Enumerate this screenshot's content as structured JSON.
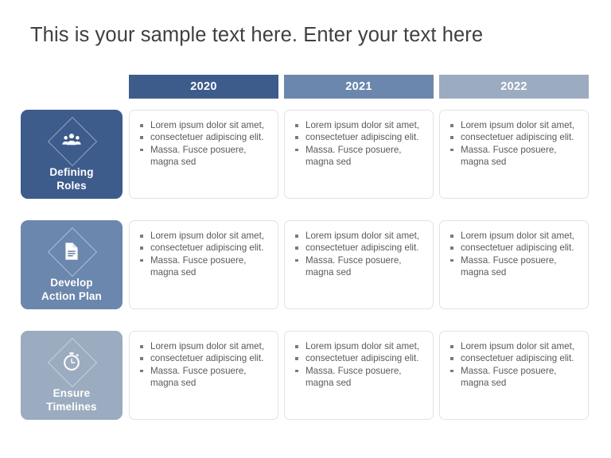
{
  "slide": {
    "title": "This is your sample text here. Enter your text here",
    "background_color": "#ffffff",
    "title_color": "#404040"
  },
  "palette": {
    "shade_1": "#3d5c8c",
    "shade_2": "#6c87ad",
    "shade_3": "#9bacc0",
    "card_border": "#e2e2e4",
    "card_background": "#ffffff",
    "body_text": "#595959",
    "bullet_marker": "#7b7b7b",
    "header_text": "#ffffff"
  },
  "columns": [
    {
      "label": "2020",
      "color": "#3d5c8c"
    },
    {
      "label": "2021",
      "color": "#6c87ad"
    },
    {
      "label": "2022",
      "color": "#9bacc0"
    }
  ],
  "rows": [
    {
      "label": "Defining Roles",
      "label_line_1": "Defining",
      "label_line_2": "Roles",
      "icon": "people-group-icon",
      "color": "#3d5c8c"
    },
    {
      "label": "Develop Action Plan",
      "label_line_1": "Develop",
      "label_line_2": "Action Plan",
      "icon": "document-icon",
      "color": "#6c87ad"
    },
    {
      "label": "Ensure Timelines",
      "label_line_1": "Ensure",
      "label_line_2": "Timelines",
      "icon": "stopwatch-icon",
      "color": "#9bacc0"
    }
  ],
  "cells": [
    [
      {
        "bullets": [
          "Lorem ipsum dolor sit amet,",
          "consectetuer adipiscing elit.",
          "Massa. Fusce posuere, magna sed"
        ]
      },
      {
        "bullets": [
          "Lorem ipsum dolor sit amet,",
          "consectetuer adipiscing elit.",
          "Massa. Fusce posuere, magna sed"
        ]
      },
      {
        "bullets": [
          "Lorem ipsum dolor sit amet,",
          "consectetuer adipiscing elit.",
          "Massa. Fusce posuere, magna sed"
        ]
      }
    ],
    [
      {
        "bullets": [
          "Lorem ipsum dolor sit amet,",
          "consectetuer adipiscing elit.",
          "Massa. Fusce posuere, magna sed"
        ]
      },
      {
        "bullets": [
          "Lorem ipsum dolor sit amet,",
          "consectetuer adipiscing elit.",
          "Massa. Fusce posuere, magna sed"
        ]
      },
      {
        "bullets": [
          "Lorem ipsum dolor sit amet,",
          "consectetuer adipiscing elit.",
          "Massa. Fusce posuere, magna sed"
        ]
      }
    ],
    [
      {
        "bullets": [
          "Lorem ipsum dolor sit amet,",
          "consectetuer adipiscing elit.",
          "Massa. Fusce posuere, magna sed"
        ]
      },
      {
        "bullets": [
          "Lorem ipsum dolor sit amet,",
          "consectetuer adipiscing elit.",
          "Massa. Fusce posuere, magna sed"
        ]
      },
      {
        "bullets": [
          "Lorem ipsum dolor sit amet,",
          "consectetuer adipiscing elit.",
          "Massa. Fusce posuere, magna sed"
        ]
      }
    ]
  ]
}
